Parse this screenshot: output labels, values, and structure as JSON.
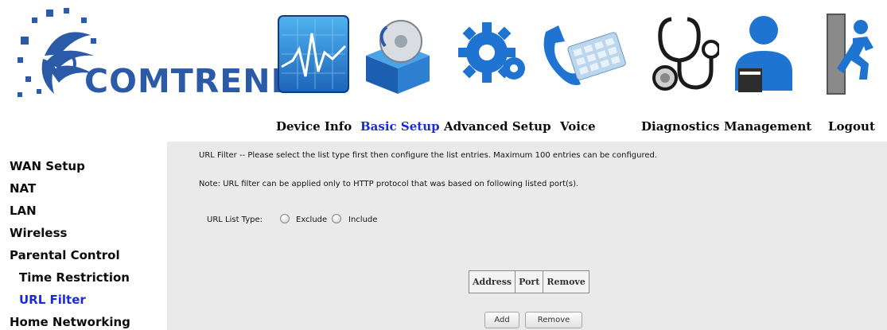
{
  "brand": {
    "name": "COMTREND"
  },
  "nav": {
    "items": [
      {
        "label": "Device Info",
        "icon": "pulse-monitor-icon"
      },
      {
        "label": "Basic Setup",
        "icon": "setup-box-disc-icon",
        "active": true
      },
      {
        "label": "Advanced Setup",
        "icon": "gears-icon"
      },
      {
        "label": "Voice",
        "icon": "phone-handset-icon"
      },
      {
        "label": "Diagnostics",
        "icon": "stethoscope-icon"
      },
      {
        "label": "Management",
        "icon": "user-admin-icon"
      },
      {
        "label": "Logout",
        "icon": "exit-door-icon"
      }
    ]
  },
  "sidebar": {
    "items": [
      {
        "label": "WAN Setup"
      },
      {
        "label": "NAT"
      },
      {
        "label": "LAN"
      },
      {
        "label": "Wireless"
      },
      {
        "label": "Parental Control"
      },
      {
        "label": "Time Restriction"
      },
      {
        "label": "URL Filter",
        "active": true
      },
      {
        "label": "Home Networking"
      }
    ]
  },
  "main": {
    "intro": "URL Filter -- Please select the list type first then configure the list entries. Maximum 100 entries can be configured.",
    "note": "Note: URL filter can be applied only to HTTP protocol that was based on following listed port(s).",
    "list_type_label": "URL List Type:",
    "radio_exclude": "Exclude",
    "radio_include": "Include",
    "table": {
      "headers": [
        "Address",
        "Port",
        "Remove"
      ]
    },
    "buttons": {
      "add": "Add",
      "remove": "Remove"
    }
  },
  "colors": {
    "accent": "#1b2bd8",
    "brand_blue": "#2b5aa8",
    "content_bg": "#eaeaea"
  }
}
